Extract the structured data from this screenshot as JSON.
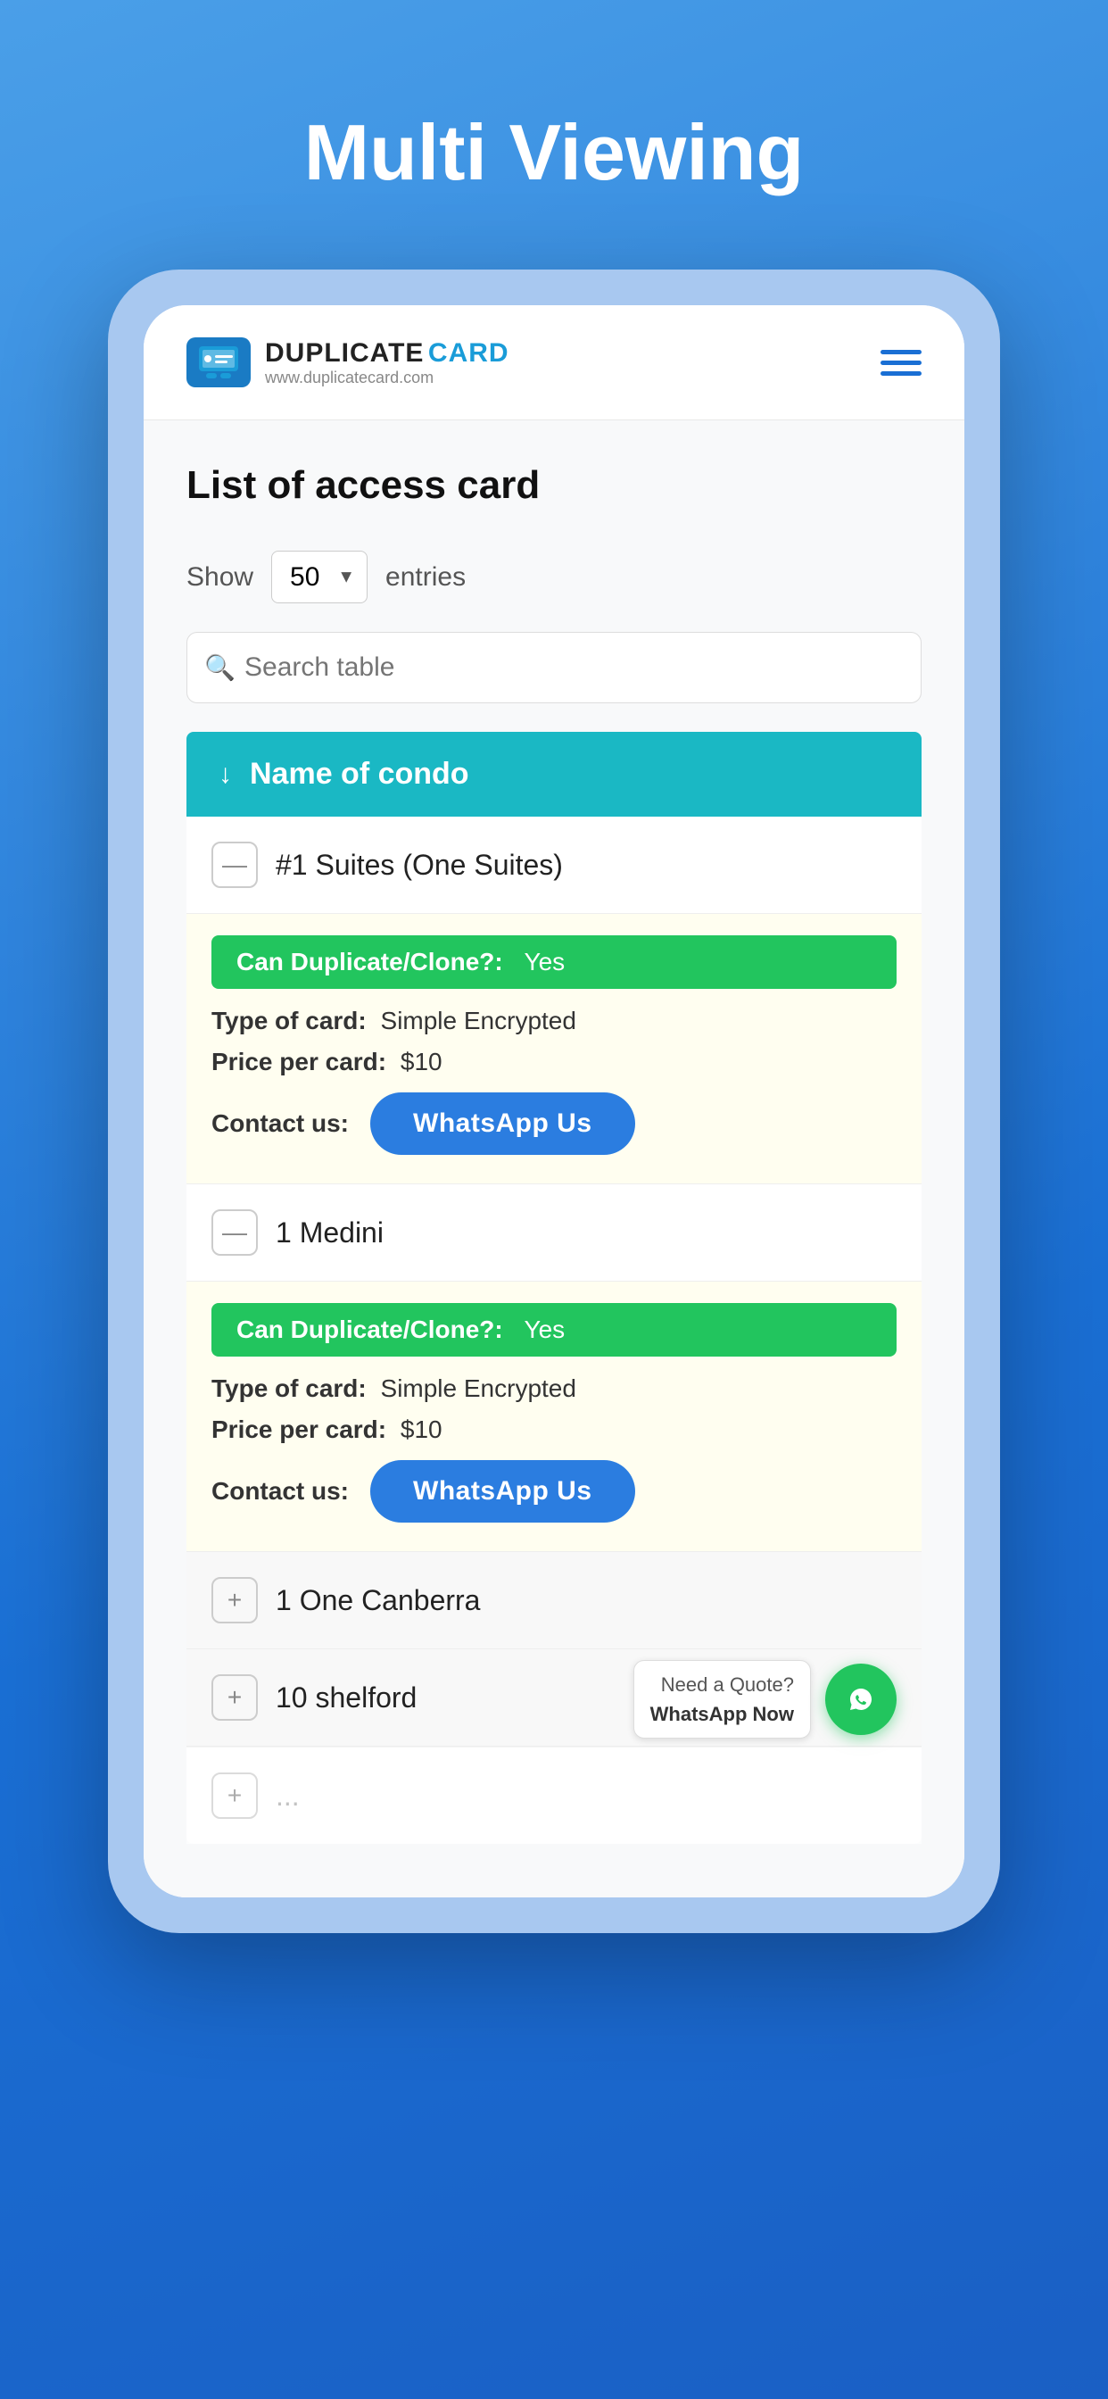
{
  "page": {
    "title": "Multi Viewing",
    "background_color": "#3a8de0"
  },
  "header": {
    "logo_duplicate": "DUPLICATE",
    "logo_card": "CARD",
    "logo_url": "www.duplicatecard.com",
    "menu_label": "menu"
  },
  "content": {
    "page_heading": "List of access card",
    "show_label": "Show",
    "entries_label": "entries",
    "entries_value": "50",
    "search_placeholder": "Search table",
    "table_column_header": "Name of condo",
    "sort_direction": "↓"
  },
  "rows": [
    {
      "id": "row1",
      "name": "#1 Suites (One Suites)",
      "toggle": "minus",
      "expanded": true,
      "can_duplicate": "Can Duplicate/Clone?",
      "can_duplicate_answer": "Yes",
      "type_label": "Type of card",
      "type_value": "Simple Encrypted",
      "price_label": "Price per card",
      "price_value": "$10",
      "contact_label": "Contact us",
      "whatsapp_label": "WhatsApp Us"
    },
    {
      "id": "row2",
      "name": "1 Medini",
      "toggle": "minus",
      "expanded": true,
      "can_duplicate": "Can Duplicate/Clone?",
      "can_duplicate_answer": "Yes",
      "type_label": "Type of card",
      "type_value": "Simple Encrypted",
      "price_label": "Price per card",
      "price_value": "$10",
      "contact_label": "Contact us",
      "whatsapp_label": "WhatsApp Us"
    },
    {
      "id": "row3",
      "name": "1 One Canberra",
      "toggle": "plus",
      "expanded": false
    },
    {
      "id": "row4",
      "name": "10 shelford",
      "toggle": "plus",
      "expanded": false
    },
    {
      "id": "row5",
      "name": "",
      "toggle": "plus",
      "expanded": false,
      "partial": true
    }
  ],
  "fab": {
    "line1": "Need a Quote?",
    "line2": "WhatsApp Now",
    "icon": "whatsapp"
  }
}
